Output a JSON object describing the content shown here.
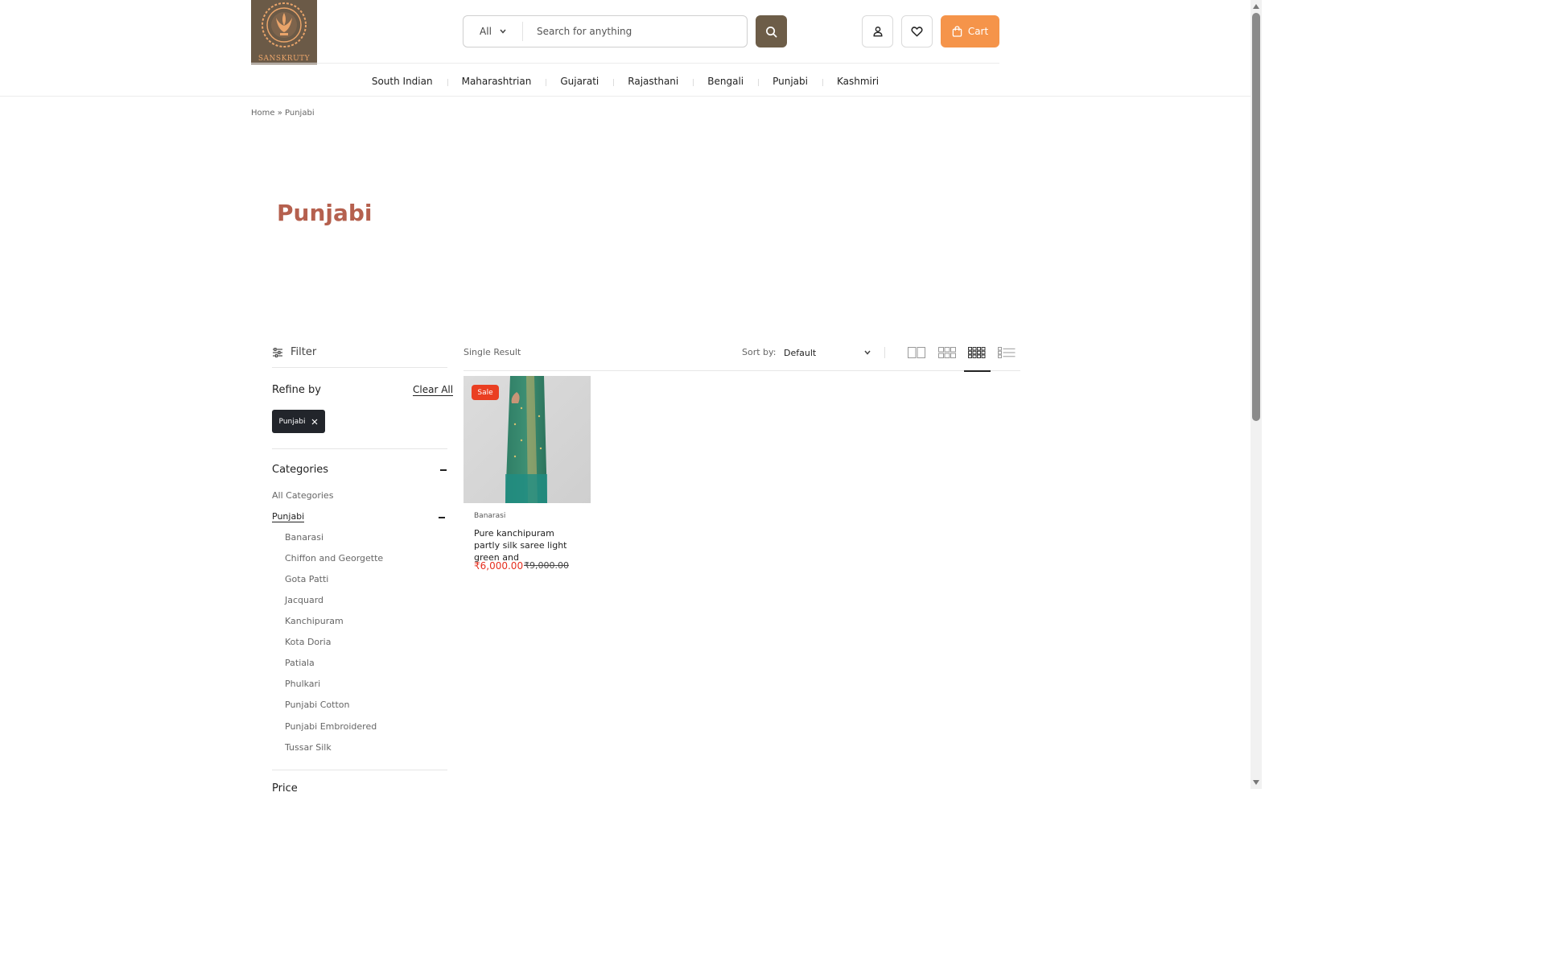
{
  "brand": {
    "name": "SANSKRUTY",
    "logo_icon": "lotus-emblem",
    "logo_bg": "#6b5a47",
    "accent": "#e9a46a"
  },
  "search": {
    "category": "All",
    "placeholder": "Search for anything",
    "icon": "search-icon"
  },
  "header": {
    "account_icon": "user-icon",
    "wishlist_icon": "heart-icon",
    "cart_label": "Cart",
    "cart_color": "#f5944a"
  },
  "nav": {
    "items": [
      "South Indian",
      "Maharashtrian",
      "Gujarati",
      "Rajasthani",
      "Bengali",
      "Punjabi",
      "Kashmiri"
    ]
  },
  "breadcrumb": {
    "home": "Home",
    "separator": "»",
    "current": "Punjabi"
  },
  "page": {
    "title": "Punjabi",
    "title_color": "#b5604e"
  },
  "filter": {
    "label": "Filter",
    "refine_title": "Refine by",
    "clear_all": "Clear All",
    "active_chip": "Punjabi"
  },
  "categories": {
    "title": "Categories",
    "all": "All Categories",
    "parent": "Punjabi",
    "children": [
      "Banarasi",
      "Chiffon and Georgette",
      "Gota Patti",
      "Jacquard",
      "Kanchipuram",
      "Kota Doria",
      "Patiala",
      "Phulkari",
      "Punjabi Cotton",
      "Punjabi Embroidered",
      "Tussar Silk"
    ],
    "next_section": "Price"
  },
  "toolbar": {
    "result_count": "Single Result",
    "sort_label": "Sort by:",
    "sort_value": "Default",
    "views": [
      "grid-2-icon",
      "grid-3-icon",
      "grid-4-icon",
      "list-icon"
    ],
    "active_view": "grid-4-icon"
  },
  "product": {
    "badge": "Sale",
    "category": "Banarasi",
    "title": "Pure kanchipuram partly silk saree light green and",
    "price": "₹6,000.00",
    "old_price": "₹9,000.00",
    "sale_color": "#ea3f22"
  }
}
